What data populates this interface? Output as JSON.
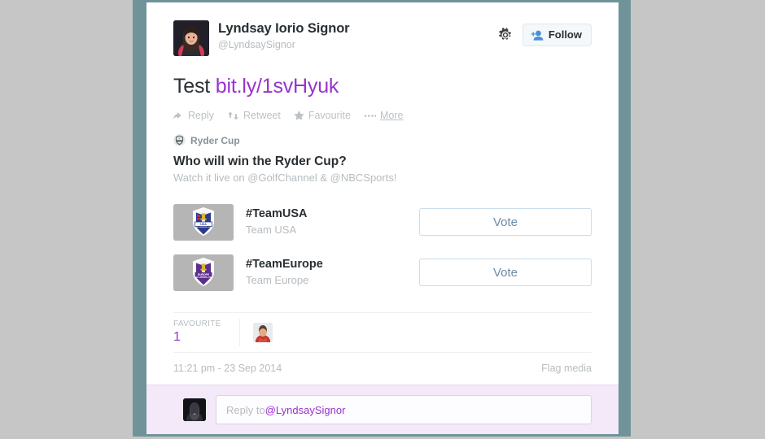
{
  "colors": {
    "page_background": "#c6c6c6",
    "frame": "#6f9398",
    "card_background": "#ffffff",
    "link": "#9933cc",
    "vote_border": "#cbdcea",
    "vote_text": "#6a8aa5",
    "reply_bar_background": "#f3e9f8"
  },
  "profile": {
    "full_name": "Lyndsay Iorio Signor",
    "handle": "@LyndsaySignor",
    "avatar_alt": "lyndsay-avatar"
  },
  "header": {
    "gear_icon": "gear-icon",
    "follow_label": "Follow",
    "follow_icon": "add-person-icon"
  },
  "tweet": {
    "text_prefix": "Test ",
    "link_text": "bit.ly/1svHyuk"
  },
  "actions": [
    {
      "icon": "reply-arrow-icon",
      "label": "Reply",
      "underline": false
    },
    {
      "icon": "retweet-icon",
      "label": "Retweet",
      "underline": false
    },
    {
      "icon": "star-icon",
      "label": "Favourite",
      "underline": false
    },
    {
      "icon": "ellipsis-icon",
      "label": "More",
      "underline": true
    }
  ],
  "card": {
    "brand_name": "Ryder Cup",
    "brand_logo": "ryder-cup-logo-icon",
    "title": "Who will win the Ryder Cup?",
    "subtitle": "Watch it live on @GolfChannel & @NBCSports!",
    "options": [
      {
        "title": "#TeamUSA",
        "subtitle": "Team USA",
        "thumb": "team-usa-crest",
        "vote_label": "Vote"
      },
      {
        "title": "#TeamEurope",
        "subtitle": "Team Europe",
        "thumb": "team-europe-crest",
        "vote_label": "Vote"
      }
    ]
  },
  "stats": {
    "favourite_label": "FAVOURITE",
    "favourite_count": "1",
    "faces": [
      {
        "alt": "favouriter-avatar"
      }
    ]
  },
  "footer": {
    "timestamp": "11:21 pm - 23 Sep 2014",
    "flag_label": "Flag media"
  },
  "reply": {
    "avatar_alt": "current-user-avatar",
    "placeholder_prefix": "Reply to ",
    "placeholder_mention": "@LyndsaySignor"
  }
}
